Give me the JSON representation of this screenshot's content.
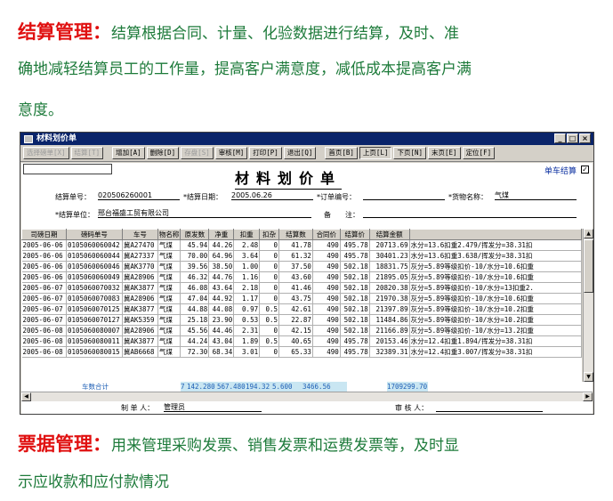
{
  "para1": {
    "heading": "结算管理：",
    "line1": "结算根据合同、计量、化验数据进行结算，及时、准",
    "line2": "确地减轻结算员工的工作量，提高客户满意度，减低成本提高客户满",
    "line3": "意度。"
  },
  "para2": {
    "heading": "票据管理：",
    "line1": "用来管理采购发票、销售发票和运费发票等，及时显",
    "line2": "示应收款和应付款情况"
  },
  "window": {
    "title": "材料划价单",
    "controls": [
      "_",
      "□",
      "×"
    ]
  },
  "toolbar": {
    "buttons": [
      {
        "label": "选择磅单[X]",
        "state": "disabled"
      },
      {
        "label": "结算[T]",
        "state": "disabled"
      },
      {
        "label": "增加[A]",
        "state": "normal"
      },
      {
        "label": "删除[D]",
        "state": "normal"
      },
      {
        "label": "存盘[S]",
        "state": "disabled"
      },
      {
        "label": "审核[M]",
        "state": "normal"
      },
      {
        "label": "打印[P]",
        "state": "normal"
      },
      {
        "label": "退出[Q]",
        "state": "normal"
      },
      {
        "label": "首页[B]",
        "state": "normal"
      },
      {
        "label": "上页[L]",
        "state": "pressed"
      },
      {
        "label": "下页[N]",
        "state": "normal"
      },
      {
        "label": "末页[E]",
        "state": "normal"
      },
      {
        "label": "定位[F]",
        "state": "normal"
      }
    ]
  },
  "form": {
    "doc_title": "材料划价单",
    "single_car_label": "单车结算",
    "single_car_checked": "✓",
    "fields": {
      "settle_no_label": "结算单号：",
      "settle_no": "020506260001",
      "settle_date_label": "*结算日期：",
      "settle_date": "2005.06.26",
      "order_no_label": "*订单编号：",
      "order_no": "",
      "goods_label": "*货物名称：",
      "goods": "气煤",
      "unit_label": "*结算单位：",
      "unit": "邢台福盛工贸有限公司",
      "remark_label": "备　　注："
    }
  },
  "table": {
    "columns": [
      "司磅日期",
      "磅码单号",
      "车号",
      "物名称",
      "原发数",
      "净重",
      "扣重",
      "扣杂",
      "结算数",
      "合同价",
      "结算价",
      "结算金额",
      ""
    ],
    "rows": [
      [
        "2005-06-06",
        "0105060060042",
        "冀A27470",
        "气煤",
        "45.94",
        "44.26",
        "2.48",
        "0",
        "41.78",
        "490",
        "495.78",
        "20713.69",
        "水分=13.6扣重2.479/挥发分=38.31扣"
      ],
      [
        "2005-06-06",
        "0105060060044",
        "冀A27337",
        "气煤",
        "70.00",
        "64.96",
        "3.64",
        "0",
        "61.32",
        "490",
        "495.78",
        "30401.23",
        "水分=13.6扣重3.638/挥发分=38.31扣"
      ],
      [
        "2005-06-06",
        "0105060060046",
        "冀AK3770",
        "气煤",
        "39.56",
        "38.50",
        "1.00",
        "0",
        "37.50",
        "490",
        "502.18",
        "18831.75",
        "灰分=5.89等级扣价-10/水分=10.6扣重"
      ],
      [
        "2005-06-06",
        "0105060060049",
        "冀A28906",
        "气煤",
        "46.32",
        "44.76",
        "1.16",
        "0",
        "43.60",
        "490",
        "502.18",
        "21895.05",
        "灰分=5.89等级扣价-10/水分=10.6扣重"
      ],
      [
        "2005-06-07",
        "0105060070032",
        "冀AK3877",
        "气煤",
        "46.08",
        "43.64",
        "2.18",
        "0",
        "41.46",
        "490",
        "502.18",
        "20820.38",
        "灰分=5.89等级扣价-10/水分=13扣重2."
      ],
      [
        "2005-06-07",
        "0105060070083",
        "冀A28906",
        "气煤",
        "47.04",
        "44.92",
        "1.17",
        "0",
        "43.75",
        "490",
        "502.18",
        "21970.38",
        "灰分=5.89等级扣价-10/水分=10.6扣重"
      ],
      [
        "2005-06-07",
        "0105060070125",
        "冀AK3877",
        "气煤",
        "44.88",
        "44.08",
        "0.97",
        "0.5",
        "42.61",
        "490",
        "502.18",
        "21397.89",
        "灰分=5.89等级扣价-10/水分=10.2扣重"
      ],
      [
        "2005-06-07",
        "0105060070127",
        "冀AK5359",
        "气煤",
        "25.18",
        "23.90",
        "0.53",
        "0.5",
        "22.87",
        "490",
        "502.18",
        "11484.86",
        "灰分=5.89等级扣价-10/水分=10.2扣重"
      ],
      [
        "2005-06-08",
        "0105060080007",
        "冀A28906",
        "气煤",
        "45.56",
        "44.46",
        "2.31",
        "0",
        "42.15",
        "490",
        "502.18",
        "21166.89",
        "灰分=5.89等级扣价-10/水分=13.2扣重"
      ],
      [
        "2005-06-08",
        "0105060080011",
        "冀AK3877",
        "气煤",
        "44.24",
        "43.04",
        "1.89",
        "0.5",
        "40.65",
        "490",
        "495.78",
        "20153.46",
        "水分=12.4扣重1.894/挥发分=38.31扣"
      ],
      [
        "2005-06-08",
        "0105060080015",
        "冀AB6668",
        "气煤",
        "72.30",
        "68.34",
        "3.01",
        "0",
        "65.33",
        "490",
        "495.78",
        "32389.31",
        "水分=12.4扣重3.007/挥发分=38.31扣"
      ]
    ]
  },
  "totals": {
    "label": "车数合计",
    "count": "7",
    "orig": "142.280",
    "net": "567.480",
    "deduct": "194.32",
    "impurity": "5.600",
    "settle": "3466.56",
    "amount": "1709299.70"
  },
  "footer": {
    "maker_label": "制 单 人：",
    "maker": "管理员",
    "reviewer_label": "审 核 人："
  }
}
